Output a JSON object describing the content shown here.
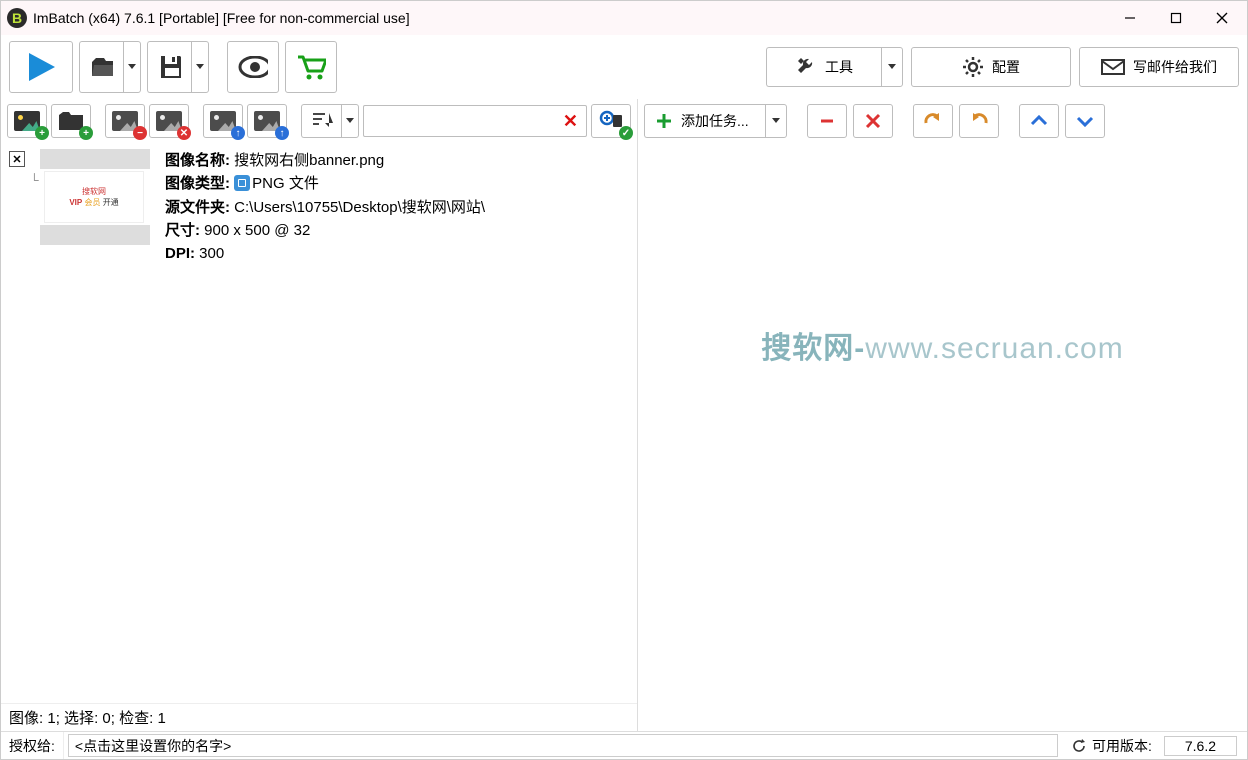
{
  "titlebar": {
    "title": "ImBatch (x64) 7.6.1 [Portable] [Free for non-commercial use]"
  },
  "main_toolbar": {
    "tools_label": "工具",
    "settings_label": "配置",
    "email_label": "写邮件给我们"
  },
  "right_tools": {
    "add_task_label": "添加任务..."
  },
  "file_item": {
    "name_label": "图像名称:",
    "name_value": "搜软网右侧banner.png",
    "type_label": "图像类型:",
    "type_value": "PNG 文件",
    "folder_label": "源文件夹:",
    "folder_value": "C:\\Users\\10755\\Desktop\\搜软网\\网站\\",
    "size_label": "尺寸:",
    "size_value": "900 x 500 @ 32",
    "dpi_label": "DPI:",
    "dpi_value": "300",
    "thumb_text1": "搜软网",
    "thumb_text2": "VIP 会员 开通"
  },
  "stats": {
    "images_label": "图像",
    "images_count": "1",
    "selected_label": "选择",
    "selected_count": "0",
    "checked_label": "检查",
    "checked_count": "1"
  },
  "watermark": {
    "text_a": "搜软网-",
    "text_b": "www.secruan.com"
  },
  "footer": {
    "auth_label": "授权给:",
    "auth_placeholder": "<点击这里设置你的名字>",
    "avail_label": "可用版本:",
    "avail_version": "7.6.2"
  },
  "icons": {
    "play": "play-icon",
    "open": "folder-open-icon",
    "save": "save-icon",
    "preview": "eye-icon",
    "cart": "cart-icon",
    "tools": "wrench-icon",
    "settings": "gear-icon",
    "mail": "mail-icon",
    "add_image": "add-image-icon",
    "add_folder": "add-folder-icon",
    "remove_image": "remove-image-icon",
    "delete_image": "delete-image-icon",
    "upload_image": "upload-image-icon",
    "upload_image2": "upload-image2-icon",
    "sort": "sort-icon",
    "clear": "clear-icon",
    "apply_filter": "apply-filter-icon",
    "plus": "plus-icon",
    "minus": "minus-icon",
    "x": "x-icon",
    "undo": "undo-icon",
    "redo": "redo-icon",
    "up": "chevron-up-icon",
    "down": "chevron-down-icon",
    "minimize": "minimize-icon",
    "maximize": "maximize-icon",
    "close": "close-icon",
    "refresh": "refresh-icon"
  }
}
